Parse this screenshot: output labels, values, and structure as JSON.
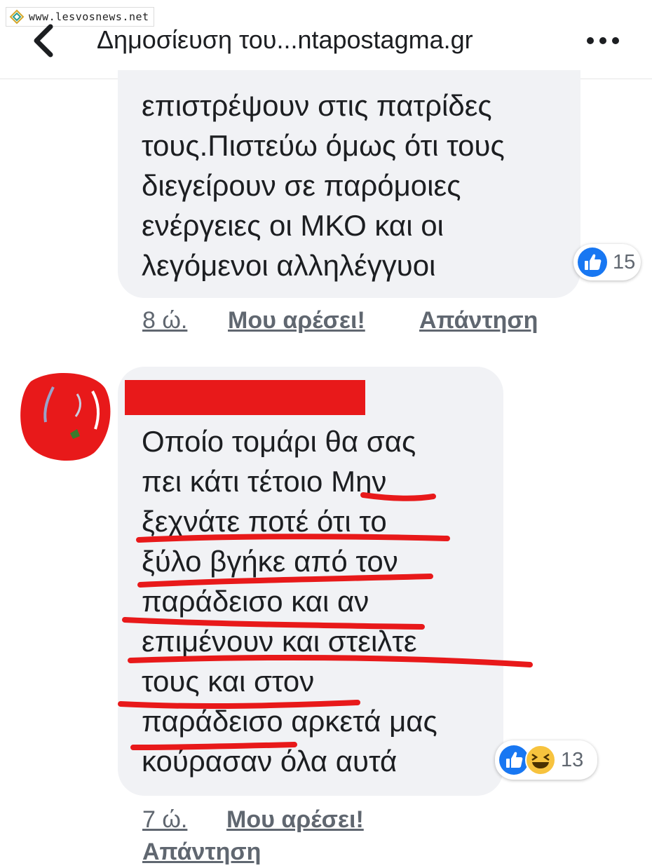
{
  "watermark": {
    "text": "www.lesvosnews.net",
    "icon": "lesvosnews-logo-icon"
  },
  "header": {
    "title": "Δημοσίευση του...ntapostagma.gr",
    "back_icon": "chevron-left-icon",
    "more_icon": "more-dots-icon"
  },
  "comments": [
    {
      "text_lines": [
        "επιστρέψουν στις πατρίδες",
        "τους.Πιστεύω όμως ότι τους",
        "διεγείρουν σε παρόμοιες",
        "ενέργειες οι ΜΚΟ και οι",
        "λεγόμενοι αλληλέγγυοι"
      ],
      "reactions": {
        "icons": [
          "like-icon"
        ],
        "count": "15"
      },
      "time": "8 ώ.",
      "like_label": "Μου αρέσει!",
      "reply_label": "Απάντηση"
    },
    {
      "author_redacted": true,
      "text_lines": [
        "Οποίο τομάρι θα σας",
        "πει κάτι τέτοιο Μην",
        "ξεχνάτε ποτέ ότι το",
        "ξύλο βγήκε από τον",
        "παράδεισο και αν",
        "επιμένουν και στειλτε",
        "τους και στον",
        "παράδεισο αρκετά μας",
        "κούρασαν όλα αυτά"
      ],
      "reactions": {
        "icons": [
          "like-icon",
          "haha-icon"
        ],
        "count": "13"
      },
      "time": "7 ώ.",
      "like_label": "Μου αρέσει!",
      "reply_label": "Απάντηση"
    }
  ],
  "colors": {
    "like_blue": "#1877f2",
    "redaction_red": "#e8191a",
    "bubble_gray": "#f1f2f5",
    "meta_gray": "#606770",
    "haha_yellow": "#f7c33e"
  }
}
